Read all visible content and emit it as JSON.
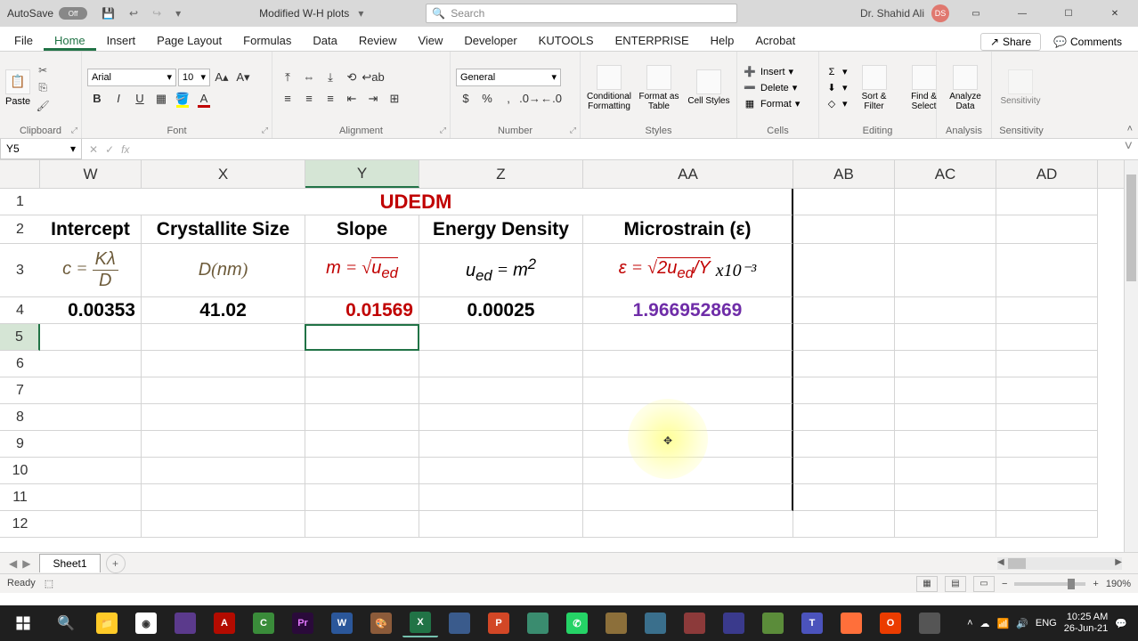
{
  "titlebar": {
    "autosave_label": "AutoSave",
    "autosave_state": "Off",
    "doc_title": "Modified W-H plots",
    "search_placeholder": "Search",
    "user_name": "Dr. Shahid Ali",
    "user_initials": "DS"
  },
  "ribbon": {
    "tabs": [
      "File",
      "Home",
      "Insert",
      "Page Layout",
      "Formulas",
      "Data",
      "Review",
      "View",
      "Developer",
      "KUTOOLS",
      "ENTERPRISE",
      "Help",
      "Acrobat"
    ],
    "active_tab": "Home",
    "share": "Share",
    "comments": "Comments",
    "font_name": "Arial",
    "font_size": "10",
    "number_format": "General",
    "groups": {
      "clipboard": "Clipboard",
      "font": "Font",
      "alignment": "Alignment",
      "number": "Number",
      "styles": "Styles",
      "cells": "Cells",
      "editing": "Editing",
      "analysis": "Analysis",
      "sensitivity": "Sensitivity"
    },
    "paste": "Paste",
    "cond_formatting": "Conditional Formatting",
    "format_table": "Format as Table",
    "cell_styles": "Cell Styles",
    "insert": "Insert",
    "delete": "Delete",
    "format": "Format",
    "sort_filter": "Sort & Filter",
    "find_select": "Find & Select",
    "analyze_data": "Analyze Data",
    "sensitivity_btn": "Sensitivity"
  },
  "namebox": {
    "value": "Y5"
  },
  "columns": [
    "W",
    "X",
    "Y",
    "Z",
    "AA",
    "AB",
    "AC",
    "AD"
  ],
  "rows": [
    "1",
    "2",
    "3",
    "4",
    "5",
    "6",
    "7",
    "8",
    "9",
    "10",
    "11",
    "12"
  ],
  "data": {
    "r1_title": "UDEDM",
    "r2": {
      "w": "Intercept",
      "x": "Crystallite Size",
      "y": "Slope",
      "z": "Energy Density",
      "aa": "Microstrain (ε)"
    },
    "r3": {
      "w": "c = Kλ / D",
      "x": "D(nm)",
      "y": "m = √u_ed",
      "z": "u_ed = m²",
      "aa": "ε = √(2u_ed/Y)",
      "aa_suffix": " x10⁻³"
    },
    "r4": {
      "w": "0.00353",
      "x": "41.02",
      "y": "0.01569",
      "z": "0.00025",
      "aa": "1.966952869"
    }
  },
  "sheets": {
    "active": "Sheet1"
  },
  "status": {
    "ready": "Ready",
    "zoom": "190%"
  },
  "taskbar": {
    "time": "10:25 AM",
    "date": "26-Jun-21"
  }
}
